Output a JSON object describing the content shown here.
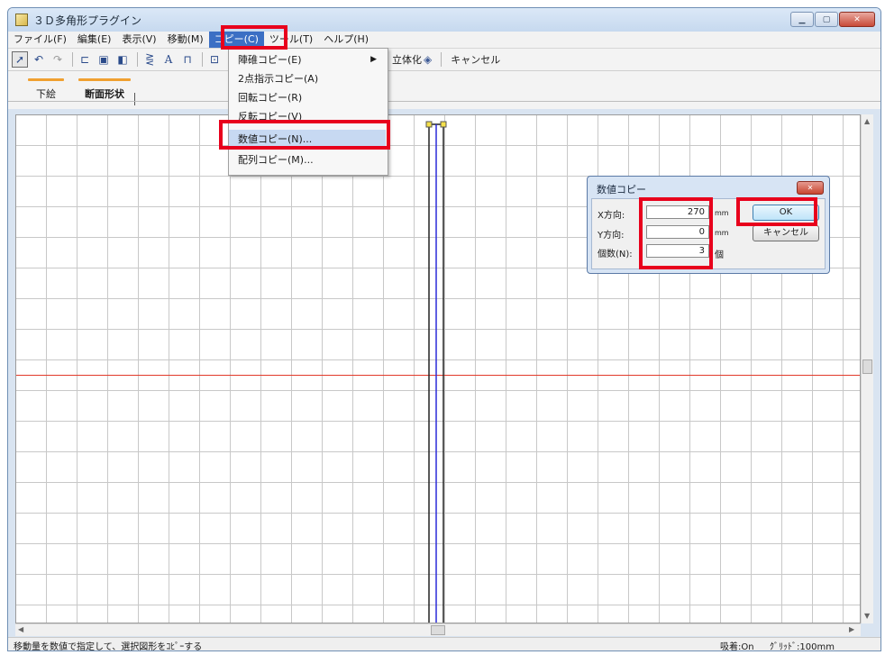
{
  "window": {
    "title": "３Ｄ多角形プラグイン",
    "controls": [
      "minimize-icon",
      "maximize-icon",
      "close-icon"
    ]
  },
  "menubar": {
    "items": [
      "ファイル(F)",
      "編集(E)",
      "表示(V)",
      "移動(M)",
      "コピー(C)",
      "ツール(T)",
      "ヘルプ(H)"
    ]
  },
  "toolbar": {
    "solidify_label": "立体化",
    "cancel_label": "キャンセル"
  },
  "tabs": [
    {
      "label": "下絵"
    },
    {
      "label": "断面形状"
    }
  ],
  "copy_menu": {
    "items": [
      {
        "label": "陣碓コピー(E)",
        "has_submenu": true
      },
      {
        "label": "2点指示コピー(A)"
      },
      {
        "label": "回転コピー(R)"
      },
      {
        "label": "反転コピー(V)"
      },
      {
        "label": "数値コピー(N)...",
        "selected": true
      },
      {
        "label": "配列コピー(M)..."
      }
    ]
  },
  "dialog": {
    "title": "数値コピー",
    "x_label": "X方向:",
    "x_value": "270",
    "y_label": "Y方向:",
    "y_value": "0",
    "count_label": "個数(N):",
    "count_value": "3",
    "unit_mm": "mm",
    "unit_count": "個",
    "ok_label": "OK",
    "cancel_label": "キャンセル"
  },
  "status": {
    "message": "移動量を数値で指定して、選択図形をｺﾋﾟｰする",
    "snap": "吸着:On",
    "grid": "ｸﾞﾘｯﾄﾞ:100mm"
  },
  "colors": {
    "highlight": "#e8001c",
    "axis_line": "#e23a2a",
    "shape_blue": "#2b2bd9",
    "tab_accent": "#f0a030"
  }
}
